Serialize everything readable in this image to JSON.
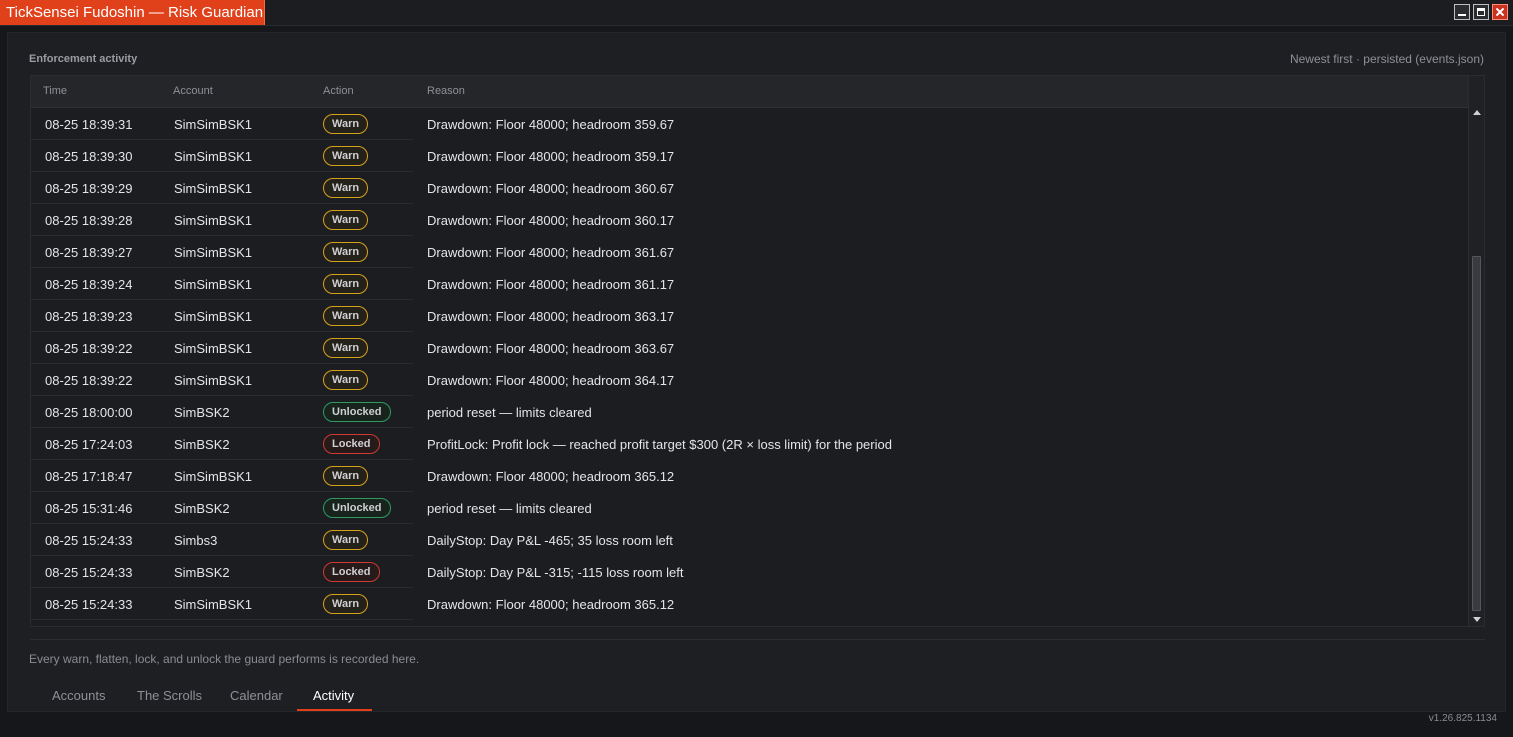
{
  "window": {
    "title": "TickSensei Fudoshin — Risk Guardian"
  },
  "activity": {
    "heading": "Enforcement activity",
    "meta": "Newest first · persisted (events.json)",
    "columns": {
      "time": "Time",
      "account": "Account",
      "action": "Action",
      "reason": "Reason"
    },
    "rows": [
      {
        "time": "08-25 18:39:31",
        "account": "SimSimBSK1",
        "action": "Warn",
        "reason": "Drawdown: Floor 48000; headroom 359.67"
      },
      {
        "time": "08-25 18:39:30",
        "account": "SimSimBSK1",
        "action": "Warn",
        "reason": "Drawdown: Floor 48000; headroom 359.17"
      },
      {
        "time": "08-25 18:39:29",
        "account": "SimSimBSK1",
        "action": "Warn",
        "reason": "Drawdown: Floor 48000; headroom 360.67"
      },
      {
        "time": "08-25 18:39:28",
        "account": "SimSimBSK1",
        "action": "Warn",
        "reason": "Drawdown: Floor 48000; headroom 360.17"
      },
      {
        "time": "08-25 18:39:27",
        "account": "SimSimBSK1",
        "action": "Warn",
        "reason": "Drawdown: Floor 48000; headroom 361.67"
      },
      {
        "time": "08-25 18:39:24",
        "account": "SimSimBSK1",
        "action": "Warn",
        "reason": "Drawdown: Floor 48000; headroom 361.17"
      },
      {
        "time": "08-25 18:39:23",
        "account": "SimSimBSK1",
        "action": "Warn",
        "reason": "Drawdown: Floor 48000; headroom 363.17"
      },
      {
        "time": "08-25 18:39:22",
        "account": "SimSimBSK1",
        "action": "Warn",
        "reason": "Drawdown: Floor 48000; headroom 363.67"
      },
      {
        "time": "08-25 18:39:22",
        "account": "SimSimBSK1",
        "action": "Warn",
        "reason": "Drawdown: Floor 48000; headroom 364.17"
      },
      {
        "time": "08-25 18:00:00",
        "account": "SimBSK2",
        "action": "Unlocked",
        "reason": "period reset — limits cleared"
      },
      {
        "time": "08-25 17:24:03",
        "account": "SimBSK2",
        "action": "Locked",
        "reason": "ProfitLock: Profit lock — reached profit target $300 (2R × loss limit) for the period"
      },
      {
        "time": "08-25 17:18:47",
        "account": "SimSimBSK1",
        "action": "Warn",
        "reason": "Drawdown: Floor 48000; headroom 365.12"
      },
      {
        "time": "08-25 15:31:46",
        "account": "SimBSK2",
        "action": "Unlocked",
        "reason": "period reset — limits cleared"
      },
      {
        "time": "08-25 15:24:33",
        "account": "Simbs3",
        "action": "Warn",
        "reason": "DailyStop: Day P&L -465; 35 loss room left"
      },
      {
        "time": "08-25 15:24:33",
        "account": "SimBSK2",
        "action": "Locked",
        "reason": "DailyStop: Day P&L -315; -115 loss room left"
      },
      {
        "time": "08-25 15:24:33",
        "account": "SimSimBSK1",
        "action": "Warn",
        "reason": "Drawdown: Floor 48000; headroom 365.12"
      }
    ],
    "footer_note": "Every warn, flatten, lock, and unlock the guard performs is recorded here."
  },
  "tabs": [
    {
      "label": "Accounts",
      "active": false
    },
    {
      "label": "The Scrolls",
      "active": false
    },
    {
      "label": "Calendar",
      "active": false
    },
    {
      "label": "Activity",
      "active": true
    }
  ],
  "version": "v1.26.825.1134",
  "colors": {
    "accent": "#e0411b",
    "warn": "#d6a21e",
    "unlocked": "#2e9c62",
    "locked": "#cc3a33"
  }
}
